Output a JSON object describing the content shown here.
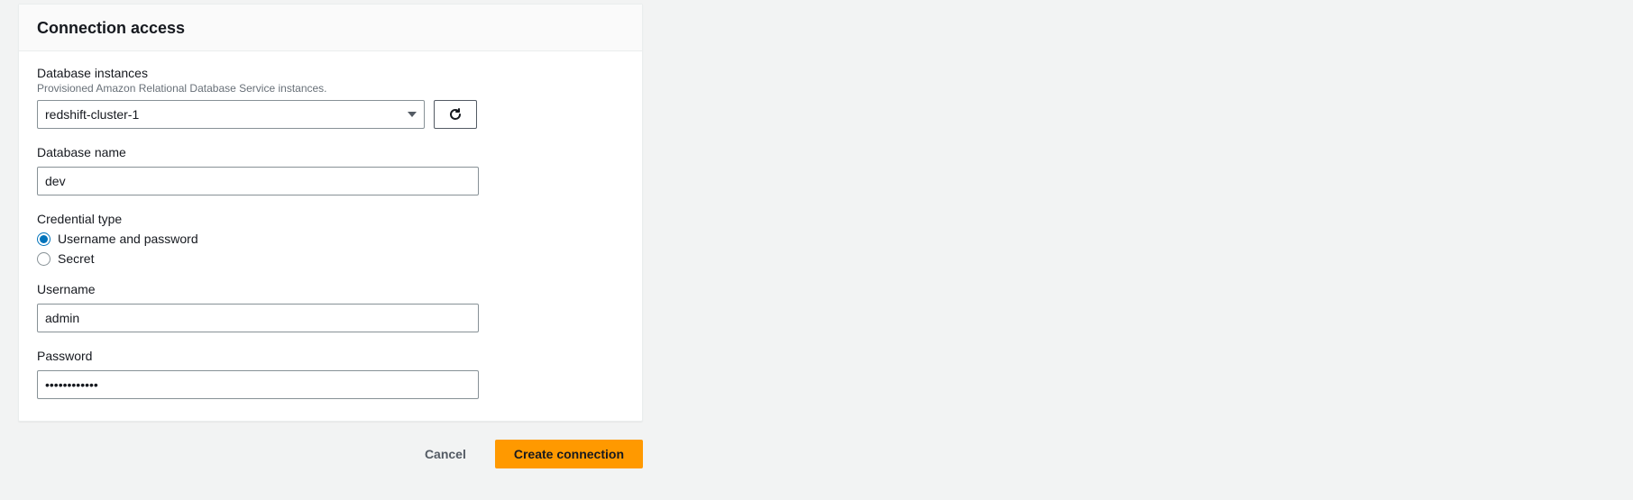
{
  "panel": {
    "title": "Connection access"
  },
  "fields": {
    "instances": {
      "label": "Database instances",
      "description": "Provisioned Amazon Relational Database Service instances.",
      "selected": "redshift-cluster-1"
    },
    "dbname": {
      "label": "Database name",
      "value": "dev"
    },
    "credential": {
      "label": "Credential type",
      "options": {
        "userpass": "Username and password",
        "secret": "Secret"
      },
      "selected": "userpass"
    },
    "username": {
      "label": "Username",
      "value": "admin"
    },
    "password": {
      "label": "Password",
      "value": "••••••••••••"
    }
  },
  "actions": {
    "cancel": "Cancel",
    "create": "Create connection"
  }
}
